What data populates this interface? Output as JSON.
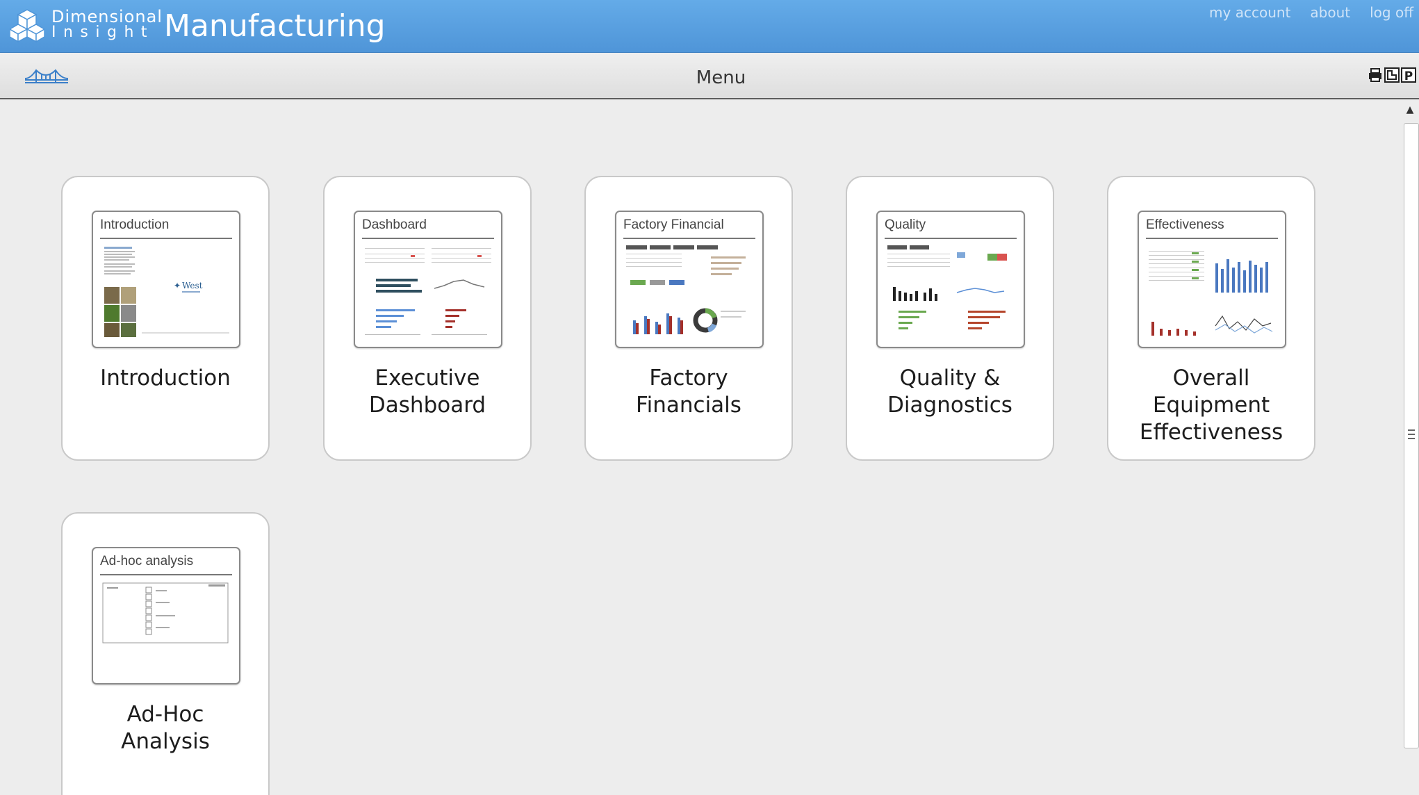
{
  "header": {
    "brand_line1": "Dimensional",
    "brand_line2": "Insight",
    "app_title": "Manufacturing",
    "links": [
      "my account",
      "about",
      "log off"
    ]
  },
  "toolbar": {
    "title": "Menu",
    "tool_p": "P"
  },
  "tiles": [
    {
      "thumb_title": "Introduction",
      "label_lines": [
        "Introduction"
      ],
      "thumb_brand": "West"
    },
    {
      "thumb_title": "Dashboard",
      "label_lines": [
        "Executive",
        "Dashboard"
      ]
    },
    {
      "thumb_title": "Factory Financial",
      "label_lines": [
        "Factory",
        "Financials"
      ]
    },
    {
      "thumb_title": "Quality",
      "label_lines": [
        "Quality &",
        "Diagnostics"
      ]
    },
    {
      "thumb_title": "Effectiveness",
      "label_lines": [
        "Overall",
        "Equipment",
        "Effectiveness"
      ]
    },
    {
      "thumb_title": "Ad-hoc analysis",
      "label_lines": [
        "Ad-Hoc",
        "Analysis"
      ]
    }
  ],
  "colors": {
    "header_bg": "#5aa1e0",
    "toolbar_bg": "#e6e6e6",
    "page_bg": "#ededed",
    "bridge_icon": "#3a7fc9"
  }
}
